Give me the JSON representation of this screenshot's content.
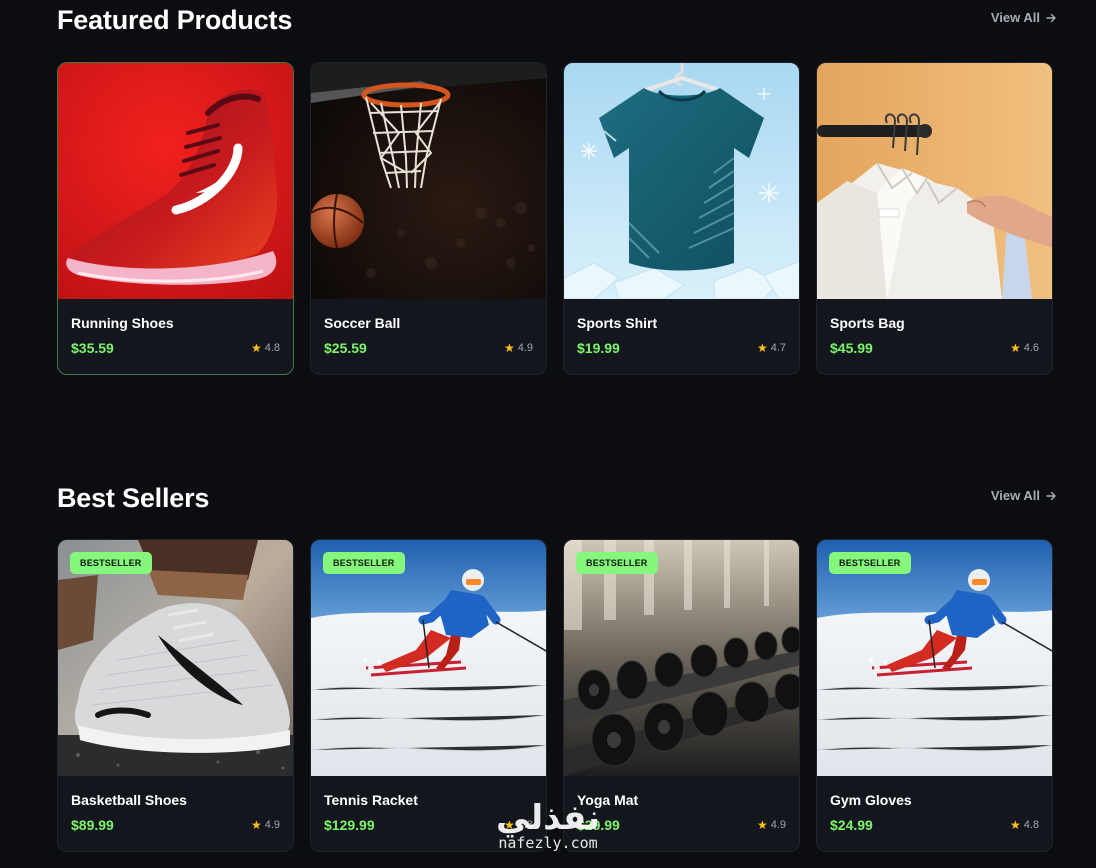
{
  "featured": {
    "title": "Featured Products",
    "view_all": "View All",
    "products": [
      {
        "name": "Running Shoes",
        "price": "$35.59",
        "rating": "4.8",
        "image": "red-running-shoe"
      },
      {
        "name": "Soccer Ball",
        "price": "$25.59",
        "rating": "4.9",
        "image": "basketball-hoop"
      },
      {
        "name": "Sports Shirt",
        "price": "$19.99",
        "rating": "4.7",
        "image": "teal-tshirt"
      },
      {
        "name": "Sports Bag",
        "price": "$45.99",
        "rating": "4.6",
        "image": "white-shirts-on-rack"
      }
    ]
  },
  "bestsellers": {
    "title": "Best Sellers",
    "view_all": "View All",
    "badge": "BESTSELLER",
    "products": [
      {
        "name": "Basketball Shoes",
        "price": "$89.99",
        "rating": "4.9",
        "image": "grey-sneaker"
      },
      {
        "name": "Tennis Racket",
        "price": "$129.99",
        "rating": "4.8",
        "image": "skier"
      },
      {
        "name": "Yoga Mat",
        "price": "$29.99",
        "rating": "4.9",
        "image": "dumbbell-rack"
      },
      {
        "name": "Gym Gloves",
        "price": "$24.99",
        "rating": "4.8",
        "image": "skier"
      }
    ]
  },
  "watermark": {
    "logo": "نفذلي",
    "url": "nafezly.com"
  },
  "colors": {
    "background": "#0b0d11",
    "card": "#13161c",
    "price": "#7cf56a",
    "badge": "#86f77d",
    "star": "#ffc21a"
  }
}
